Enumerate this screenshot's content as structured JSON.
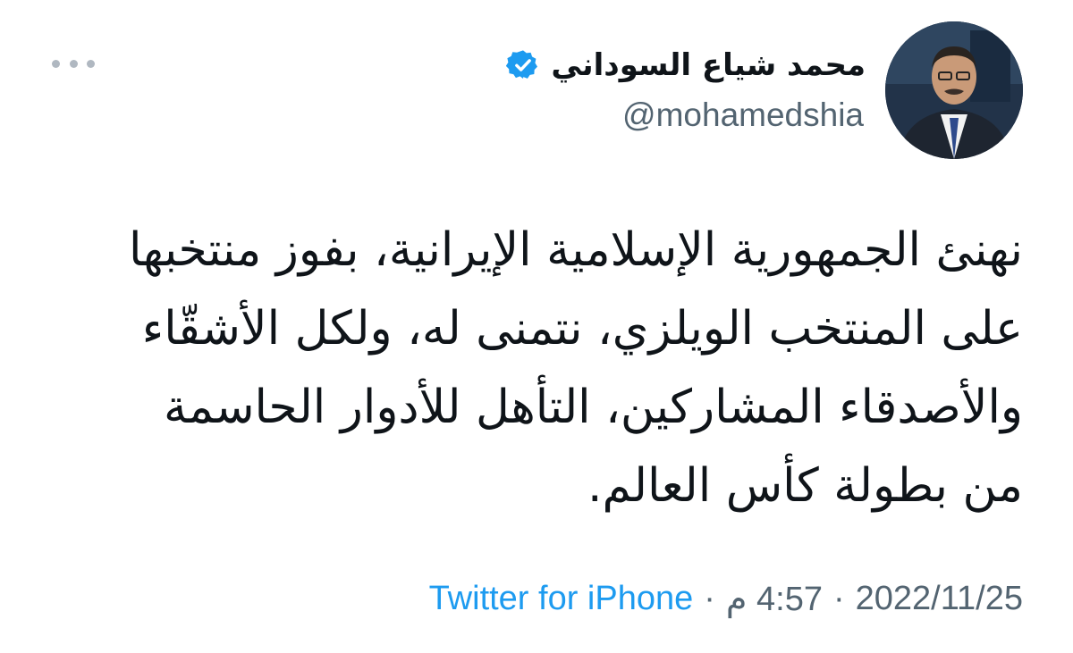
{
  "author": {
    "display_name": "محمد شياع السوداني",
    "handle": "@mohamedshia",
    "verified": true,
    "avatar_icon": "profile-photo"
  },
  "tweet": {
    "text_lines": [
      "نهنئ الجمهورية الإسلامية الإيرانية، بفوز منتخبها",
      "على المنتخب الويلزي، نتمنى له، ولكل الأشقّاء",
      "والأصدقاء المشاركين، التأهل للأدوار الحاسمة",
      "من بطولة كأس العالم."
    ]
  },
  "meta": {
    "date": "2022/11/25",
    "time": "4:57 م",
    "separator": "·",
    "source": "Twitter for iPhone"
  },
  "icons": {
    "more": "more-horizontal-icon",
    "verified": "verified-badge-icon"
  },
  "colors": {
    "accent": "#1d9bf0",
    "secondary_text": "#536471",
    "primary_text": "#0f1419"
  }
}
